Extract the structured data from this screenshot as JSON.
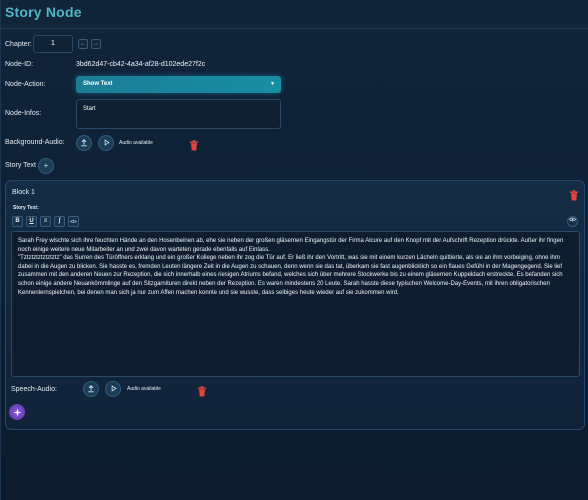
{
  "title": "Story Node",
  "chapter": {
    "label": "Chapter:",
    "value": "1",
    "prev": "←",
    "next": "→"
  },
  "node_id": {
    "label": "Node-ID:",
    "value": "3bd62d47-cb42-4a34-af28-d102ede27f2c"
  },
  "node_action": {
    "label": "Node-Action:",
    "selected": "Show Text"
  },
  "node_infos": {
    "label": "Node-Infos:",
    "value": "Start"
  },
  "background_audio": {
    "label": "Background-Audio:",
    "status": "Audio available"
  },
  "story_text": {
    "label": "Story Text",
    "add": "+"
  },
  "block": {
    "title": "Block 1",
    "editor_label": "Story Text:",
    "toolbar": [
      "B",
      "U",
      "≡",
      "∫",
      "</>"
    ],
    "paragraphs": [
      "Sarah Frey wischte sich ihre feuchten Hände an den Hosenbeinen ab, ehe sie neben der großen gläsernen Eingangstür der Firma Alcure auf den Knopf  mit der Aufschrift Rezeption drückte. Außer ihr fingen noch einige weitere neue Mitarbeiter an und zwei davon warteten gerade ebenfalls auf Einlass.",
      "\"Tztztztztztztztz\" das Surren des Türöffners erklang und ein großer Kollege neben ihr zog die Tür auf. Er ließ ihr den Vortritt, was sie mit einem kurzen Lächeln quittierte, als sie an ihm vorbeiging, ohne ihm dabei in die Augen zu blicken. Sie hasste es, fremden Leuten längere Zeit in die Augen zu schauen, denn wenn sie das tat, überkam sie fast augenblicklich so ein flaues Gefühl in der Magengegend. Sie lief zusammen mit den anderen Neuen zur Rezeption, die sich innerhalb eines riesigen Atriums befand, welches sich über mehrere Stockwerke bis zu einem gläsernen Kuppeldach erstreckte. Es befanden sich schon einige andere Neuankömmlinge auf den Sitzgarnituren direkt neben der Rezeption. Es waren mindestens 20 Leute. Sarah hasste diese typischen Welcome-Day-Events, mit ihren obligatorischen Kennenlernspielchen, bei denen man sich ja nur zum Affen machen konnte und sie wusste, dass selbiges heute wieder auf sie zukommen wird."
    ],
    "speech_audio": {
      "label": "Speech-Audio:",
      "status": "Audio available"
    }
  },
  "colors": {
    "accent": "#4fb7c7",
    "select": "#178fa3",
    "danger": "#e0443a",
    "magic": "#6a3fc0"
  }
}
